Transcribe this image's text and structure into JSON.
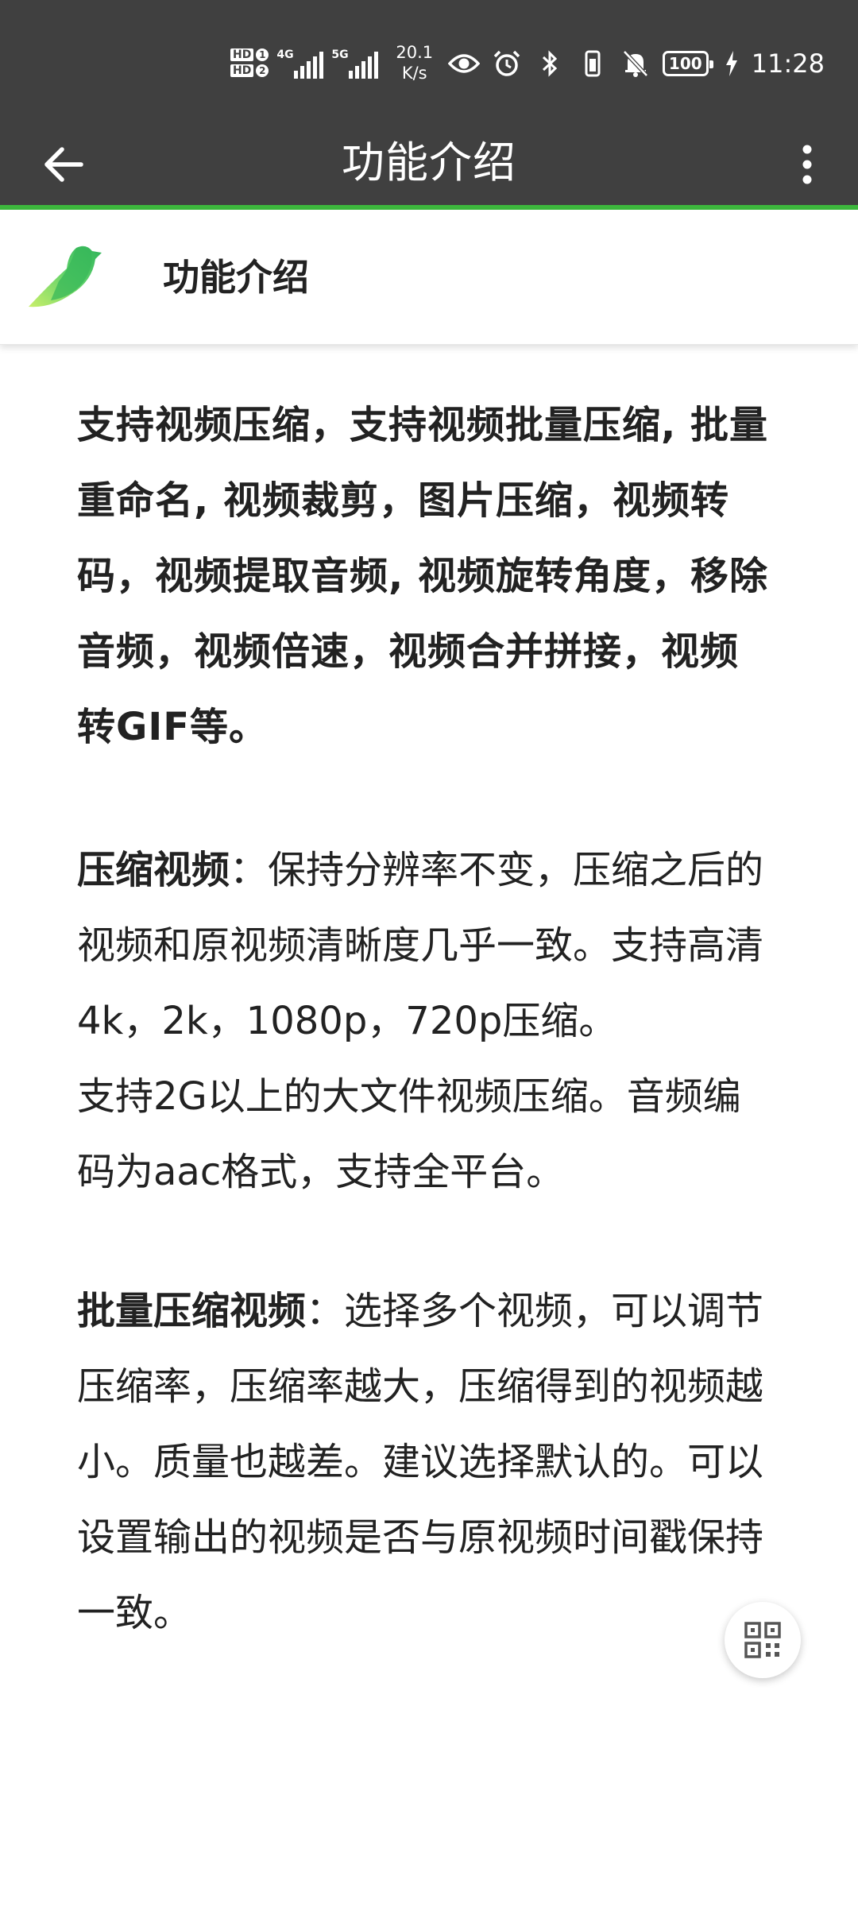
{
  "status_bar": {
    "hd1": "HD",
    "hd1_num": "1",
    "hd2": "HD",
    "hd2_num": "2",
    "net1": "4G",
    "net2": "5G",
    "speed_value": "20.1",
    "speed_unit": "K/s",
    "battery": "100",
    "time": "11:28",
    "icons": [
      "eye-icon",
      "alarm-icon",
      "bluetooth-icon",
      "vibrate-icon",
      "mute-bell-icon",
      "battery-icon",
      "charging-icon"
    ]
  },
  "app_bar": {
    "title": "功能介绍",
    "back_icon": "back-arrow-icon",
    "menu_icon": "more-vert-icon",
    "accent_color": "#3db83d"
  },
  "header": {
    "title": "功能介绍",
    "logo_icon": "bird-logo-icon"
  },
  "content": {
    "intro": "支持视频压缩，支持视频批量压缩, 批量重命名, 视频裁剪，图片压缩，视频转码，视频提取音频, 视频旋转角度，移除音频，视频倍速，视频合并拼接，视频转GIF等。",
    "sec1_title": "压缩视频",
    "sec1_body": "：保持分辨率不变，压缩之后的视频和原视频清晰度几乎一致。支持高清4k，2k，1080p，720p压缩。",
    "sec1_extra": "支持2G以上的大文件视频压缩。音频编码为aac格式，支持全平台。",
    "sec2_title": "批量压缩视频",
    "sec2_body": "：选择多个视频，可以调节压缩率，压缩率越大，压缩得到的视频越小。质量也越差。建议选择默认的。可以设置输出的视频是否与原视频时间戳保持一致。"
  },
  "fab": {
    "icon": "qr-code-icon"
  }
}
